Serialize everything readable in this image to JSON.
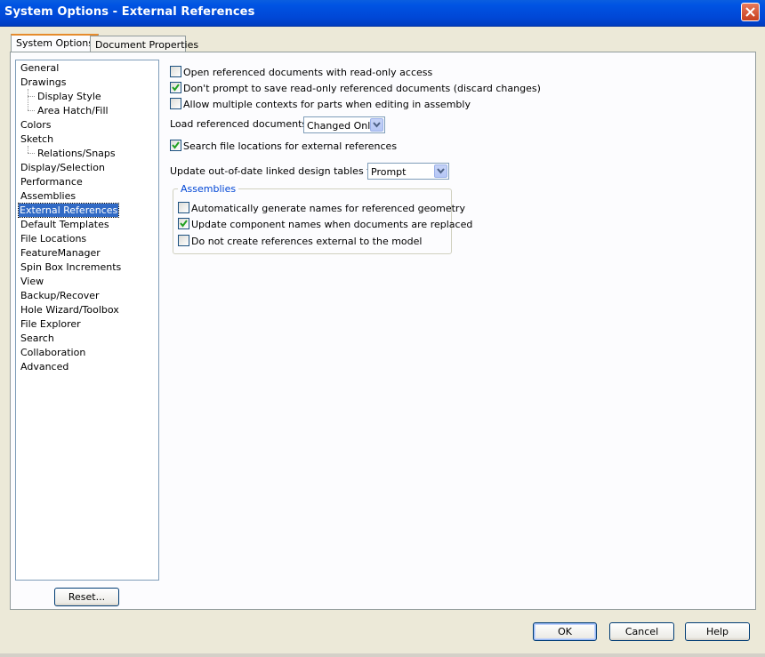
{
  "window": {
    "title": "System Options - External References"
  },
  "tabs": [
    {
      "label": "System Options",
      "active": true
    },
    {
      "label": "Document Properties",
      "active": false
    }
  ],
  "tree": {
    "items": [
      {
        "label": "General",
        "level": 0
      },
      {
        "label": "Drawings",
        "level": 0
      },
      {
        "label": "Display Style",
        "level": 1
      },
      {
        "label": "Area Hatch/Fill",
        "level": 1
      },
      {
        "label": "Colors",
        "level": 0
      },
      {
        "label": "Sketch",
        "level": 0
      },
      {
        "label": "Relations/Snaps",
        "level": 1
      },
      {
        "label": "Display/Selection",
        "level": 0
      },
      {
        "label": "Performance",
        "level": 0
      },
      {
        "label": "Assemblies",
        "level": 0
      },
      {
        "label": "External References",
        "level": 0,
        "selected": true
      },
      {
        "label": "Default Templates",
        "level": 0
      },
      {
        "label": "File Locations",
        "level": 0
      },
      {
        "label": "FeatureManager",
        "level": 0
      },
      {
        "label": "Spin Box Increments",
        "level": 0
      },
      {
        "label": "View",
        "level": 0
      },
      {
        "label": "Backup/Recover",
        "level": 0
      },
      {
        "label": "Hole Wizard/Toolbox",
        "level": 0
      },
      {
        "label": "File Explorer",
        "level": 0
      },
      {
        "label": "Search",
        "level": 0
      },
      {
        "label": "Collaboration",
        "level": 0
      },
      {
        "label": "Advanced",
        "level": 0
      }
    ],
    "reset_label": "Reset..."
  },
  "options": {
    "open_readonly": {
      "label": "Open referenced documents with read-only access",
      "checked": false
    },
    "dont_prompt_save": {
      "label": "Don't prompt to save read-only referenced documents (discard changes)",
      "checked": true
    },
    "multiple_contexts": {
      "label": "Allow multiple contexts for parts when editing in assembly",
      "checked": false
    },
    "load_referenced": {
      "label": "Load referenced documents:",
      "value": "Changed Only"
    },
    "search_file_locations": {
      "label": "Search file locations for external references",
      "checked": true
    },
    "update_design_tables": {
      "label": "Update out-of-date linked design tables to:",
      "value": "Prompt"
    }
  },
  "assemblies": {
    "title": "Assemblies",
    "auto_names": {
      "label": "Automatically generate names for referenced geometry",
      "checked": false
    },
    "update_component_names": {
      "label": "Update component names when documents are replaced",
      "checked": true
    },
    "no_external_refs": {
      "label": "Do not create references external to the model",
      "checked": false
    }
  },
  "footer": {
    "ok": "OK",
    "cancel": "Cancel",
    "help": "Help"
  },
  "colors": {
    "titlebar": "#0054e3",
    "selection": "#316ac5",
    "group_title": "#0046d5",
    "dialog_bg": "#ece9d8"
  }
}
